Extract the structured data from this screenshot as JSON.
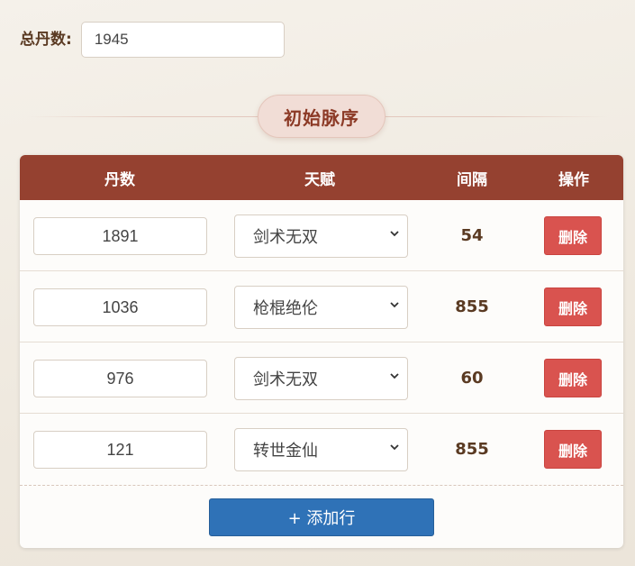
{
  "total": {
    "label": "总丹数:",
    "value": "1945"
  },
  "section": {
    "title": "初始脉序"
  },
  "table": {
    "headers": {
      "dan": "丹数",
      "talent": "天赋",
      "gap": "间隔",
      "op": "操作"
    },
    "rows": [
      {
        "dan": "1891",
        "talent": "剑术无双",
        "gap": "54",
        "delete": "删除"
      },
      {
        "dan": "1036",
        "talent": "枪棍绝伦",
        "gap": "855",
        "delete": "删除"
      },
      {
        "dan": "976",
        "talent": "剑术无双",
        "gap": "60",
        "delete": "删除"
      },
      {
        "dan": "121",
        "talent": "转世金仙",
        "gap": "855",
        "delete": "删除"
      }
    ]
  },
  "add_button": {
    "label": "+ 添加行"
  },
  "colors": {
    "header": "#954130",
    "delete": "#d9534f",
    "add": "#2f72b7"
  },
  "icons": {
    "select_arrow": "chevron-down-icon"
  }
}
